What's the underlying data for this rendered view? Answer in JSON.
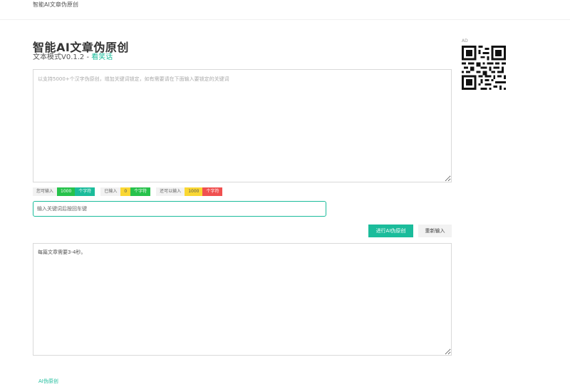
{
  "topbar": {
    "brand": "智能AI文章伪原创"
  },
  "header": {
    "title": "智能AI文章伪原创",
    "version": "文本模式V0.1.2 - ",
    "link": "看笑话"
  },
  "ad": {
    "label": "AD"
  },
  "input": {
    "placeholder": "以支持5000+个汉字伪原创，增加关键词锁定，如有需要请在下面输入要锁定的关键词"
  },
  "counters": [
    {
      "label": "您可输入",
      "value": "1000",
      "unit": "个字符"
    },
    {
      "label": "已输入",
      "value": "0",
      "unit": "个字符"
    },
    {
      "label": "还可以输入",
      "value": "1000",
      "unit": "个字符"
    }
  ],
  "keyword": {
    "placeholder": "输入关键词后按回车键"
  },
  "buttons": {
    "primary": "进行AI伪原创",
    "reset": "重新输入"
  },
  "output": {
    "text": "每篇文章需要3-4秒。"
  },
  "footer": {
    "link": "AI伪原创"
  },
  "colors": {
    "accent": "#1bbc9b",
    "green": "#27c24c",
    "yellow": "#fad733",
    "red": "#f05050"
  }
}
